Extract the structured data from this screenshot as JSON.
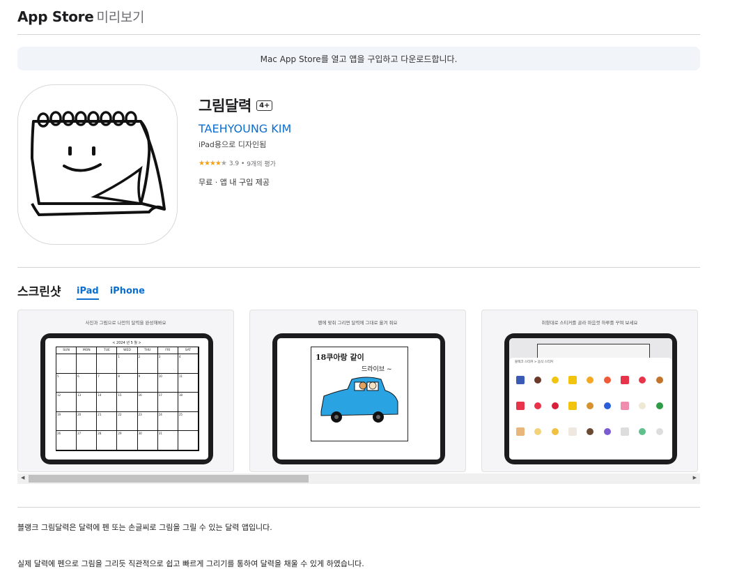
{
  "header": {
    "brand": "App Store",
    "subtitle": "미리보기"
  },
  "banner": {
    "text": "Mac App Store를 열고 앱을 구입하고 다운로드합니다."
  },
  "app": {
    "title": "그림달력",
    "age_rating": "4+",
    "developer": "TAEHYOUNG KIM",
    "designed_for": "iPad용으로 디자인됨",
    "stars": "★★★★",
    "stars_empty": "★",
    "rating": "3.9",
    "rating_count": "9개의 평가",
    "price": "무료 · 앱 내 구입 제공"
  },
  "screenshots": {
    "title": "스크린샷",
    "tabs": [
      "iPad",
      "iPhone"
    ],
    "captions": [
      "사진과 그림으로 나만의 달력을 완성해봐요",
      "펜에 맞춰 그리면 달력에 그대로 옮겨 줘요",
      "취향대로 스티커를 골라 마음껏 하루를 꾸며 보세요"
    ],
    "calendar": {
      "month_label": "< 2024 년 5 월 >",
      "days": [
        "SUN",
        "MON",
        "TUE",
        "WED",
        "THU",
        "FRI",
        "SAT"
      ],
      "numbers": [
        "",
        "",
        "",
        "1",
        "2",
        "3",
        "4",
        "5",
        "6",
        "7",
        "8",
        "9",
        "10",
        "11",
        "12",
        "13",
        "14",
        "15",
        "16",
        "17",
        "18",
        "19",
        "20",
        "21",
        "22",
        "23",
        "24",
        "25",
        "26",
        "27",
        "28",
        "29",
        "30",
        "31",
        ""
      ]
    },
    "drawing": {
      "line1": "18쿠아랑 같이",
      "line2": "드라이브 ~"
    },
    "stickers": {
      "header": "블랙크 스티커 > 음식 스티커"
    }
  },
  "description": {
    "line1": "블랭크 그림달력은 달력에 펜 또는 손글씨로 그림을 그릴 수 있는 달력 앱입니다.",
    "line2": "실제 달력에 펜으로 그림을 그리듯 직관적으로 쉽고 빠르게 그리기를 통하여 달력을 채울 수 있게 하였습니다."
  },
  "colors": {
    "accent": "#0a6ed1",
    "star": "#f0a11b",
    "banner_bg": "#f1f4f8"
  }
}
